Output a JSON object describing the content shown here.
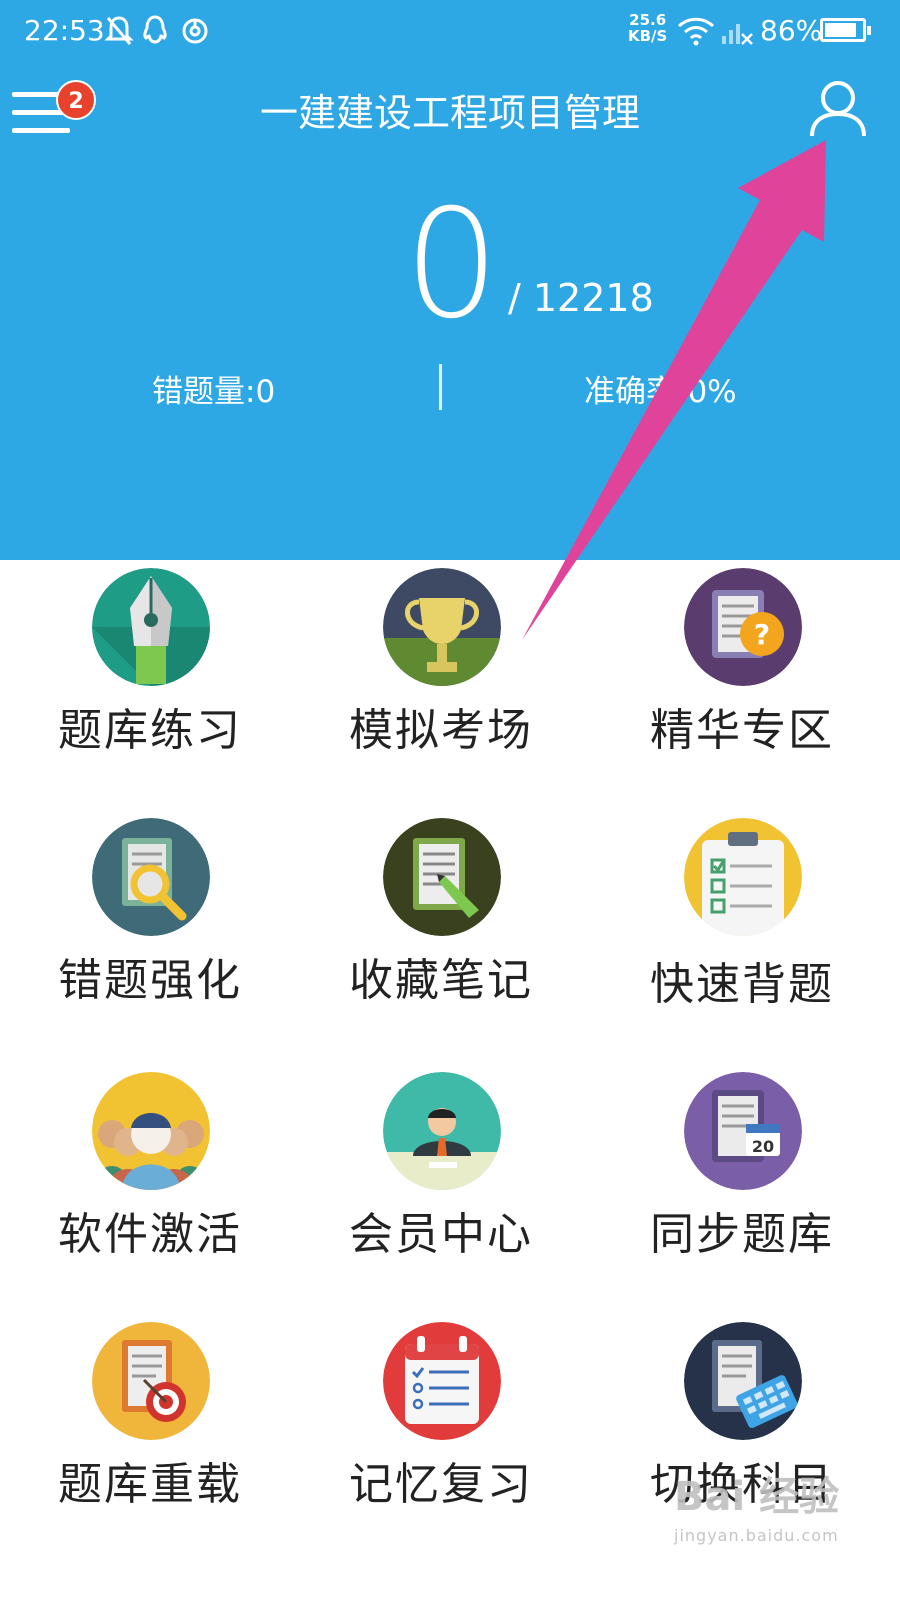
{
  "status_bar": {
    "time": "22:53",
    "speed_value": "25.6",
    "speed_unit": "KB/S",
    "battery": "86%",
    "battery_level": 0.86
  },
  "app_bar": {
    "menu_badge": "2",
    "title": "一建建设工程项目管理"
  },
  "progress": {
    "done": "0",
    "total": "/ 12218",
    "wrong_count": "错题量:0",
    "accuracy": "准确率:0%"
  },
  "colors": {
    "header_bg": "#2ea8e4",
    "badge": "#e8412c",
    "arrow": "#e0449a"
  },
  "menu": [
    {
      "label": "题库练习",
      "icon": "pen-nib-icon"
    },
    {
      "label": "模拟考场",
      "icon": "trophy-icon"
    },
    {
      "label": "精华专区",
      "icon": "document-question-icon"
    },
    {
      "label": "错题强化",
      "icon": "document-search-icon"
    },
    {
      "label": "收藏笔记",
      "icon": "note-pencil-icon"
    },
    {
      "label": "快速背题",
      "icon": "clipboard-checklist-icon"
    },
    {
      "label": "软件激活",
      "icon": "people-group-icon"
    },
    {
      "label": "会员中心",
      "icon": "member-avatar-icon"
    },
    {
      "label": "同步题库",
      "icon": "document-calendar-icon"
    },
    {
      "label": "题库重载",
      "icon": "document-target-icon"
    },
    {
      "label": "记忆复习",
      "icon": "calendar-list-icon"
    },
    {
      "label": "切换科目",
      "icon": "document-keyboard-icon"
    }
  ],
  "calendar_day": "20",
  "watermark": {
    "brand": "Bai 经验",
    "url": "jingyan.baidu.com"
  }
}
